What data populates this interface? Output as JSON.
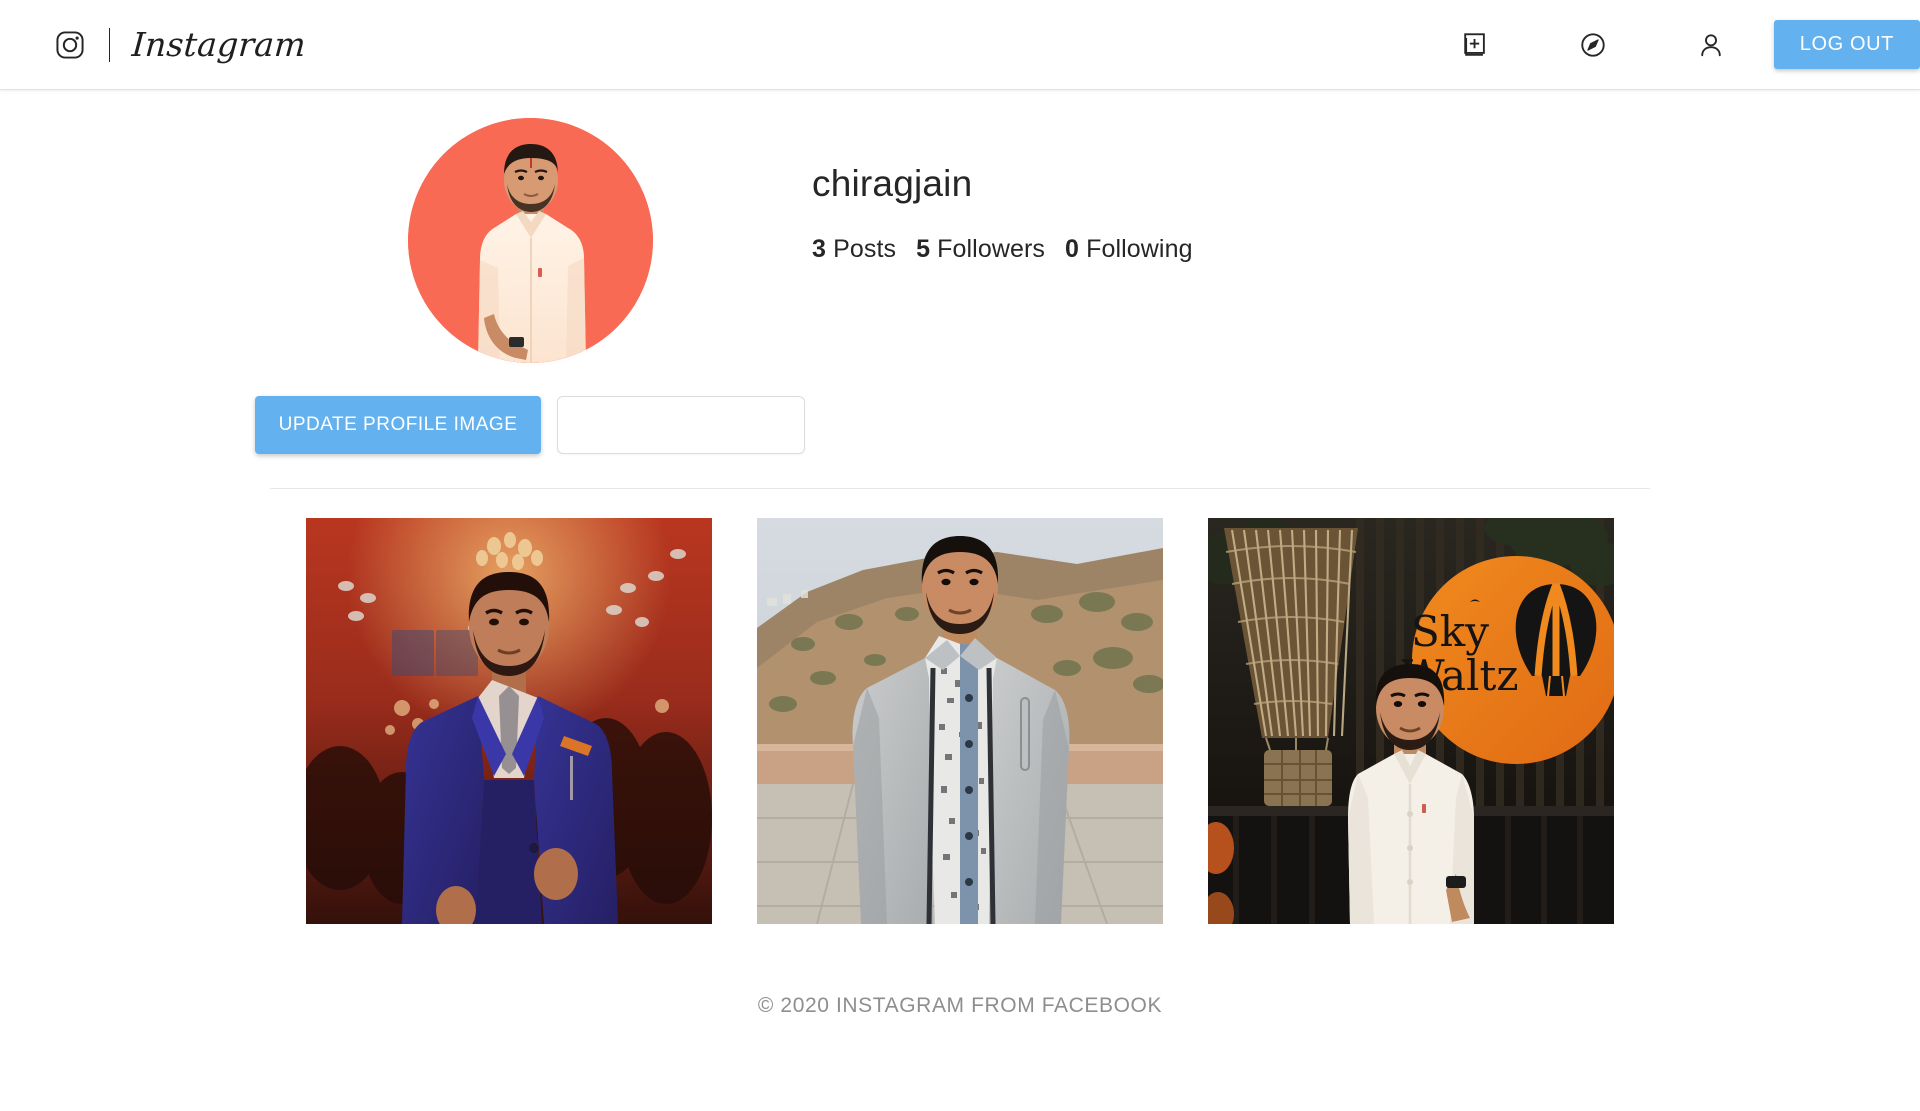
{
  "header": {
    "logo_icon": "instagram-camera-icon",
    "wordmark": "Instagram",
    "nav_icons": [
      {
        "name": "new-post-icon",
        "label": "New Post"
      },
      {
        "name": "explore-compass-icon",
        "label": "Explore"
      },
      {
        "name": "profile-person-icon",
        "label": "Profile"
      }
    ],
    "logout_label": "LOG OUT",
    "accent_color": "#63B2EF"
  },
  "profile": {
    "username": "chiragjain",
    "avatar_background": "#F96A54",
    "avatar_alt": "profile photo of a young man in a light shirt",
    "stats": [
      {
        "value": "3",
        "label": "Posts"
      },
      {
        "value": "5",
        "label": "Followers"
      },
      {
        "value": "0",
        "label": "Following"
      }
    ],
    "update_button_label": "UPDATE PROFILE IMAGE",
    "file_input_value": "",
    "file_input_placeholder": ""
  },
  "posts": [
    {
      "id": "post-1",
      "alt": "man in a blue suit with grey tie at an indoor event with warm orange lighting"
    },
    {
      "id": "post-2",
      "alt": "man in a grey jacket and patterned shirt standing outdoors with hills behind"
    },
    {
      "id": "post-3",
      "alt": "man in a white shirt in front of an orange Sky Waltz hot air balloon sign"
    }
  ],
  "footer": {
    "copyright": "© 2020 INSTAGRAM FROM FACEBOOK"
  }
}
